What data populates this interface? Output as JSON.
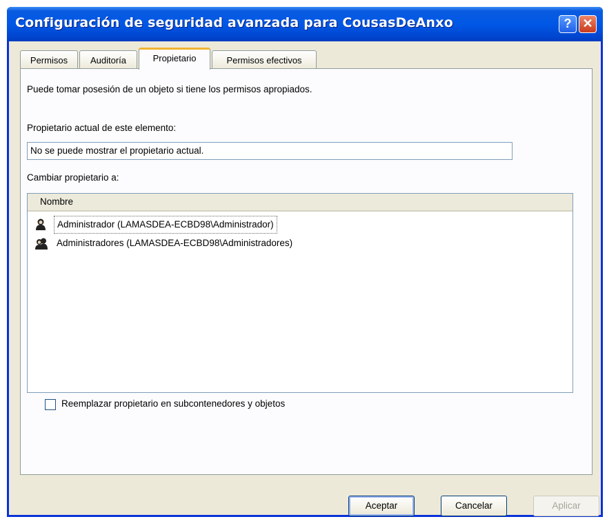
{
  "window": {
    "title": "Configuración de seguridad avanzada para CousasDeAnxo",
    "help_glyph": "?",
    "close_glyph": "✕"
  },
  "tabs": [
    {
      "label": "Permisos",
      "active": false
    },
    {
      "label": "Auditoría",
      "active": false
    },
    {
      "label": "Propietario",
      "active": true
    },
    {
      "label": "Permisos efectivos",
      "active": false
    }
  ],
  "owner": {
    "intro": "Puede tomar posesión de un objeto si tiene los permisos apropiados.",
    "current_label": "Propietario actual de este elemento:",
    "current_value": "No se puede mostrar el propietario actual.",
    "change_label": "Cambiar propietario a:",
    "column_name": "Nombre",
    "candidates": [
      {
        "label": "Administrador (LAMASDEA-ECBD98\\Administrador)",
        "icon": "user-icon",
        "selected": true
      },
      {
        "label": "Administradores (LAMASDEA-ECBD98\\Administradores)",
        "icon": "group-icon",
        "selected": false
      }
    ],
    "replace_label": "Reemplazar propietario en subcontenedores y objetos",
    "replace_checked": false
  },
  "buttons": {
    "accept": "Aceptar",
    "cancel": "Cancelar",
    "apply": "Aplicar"
  }
}
